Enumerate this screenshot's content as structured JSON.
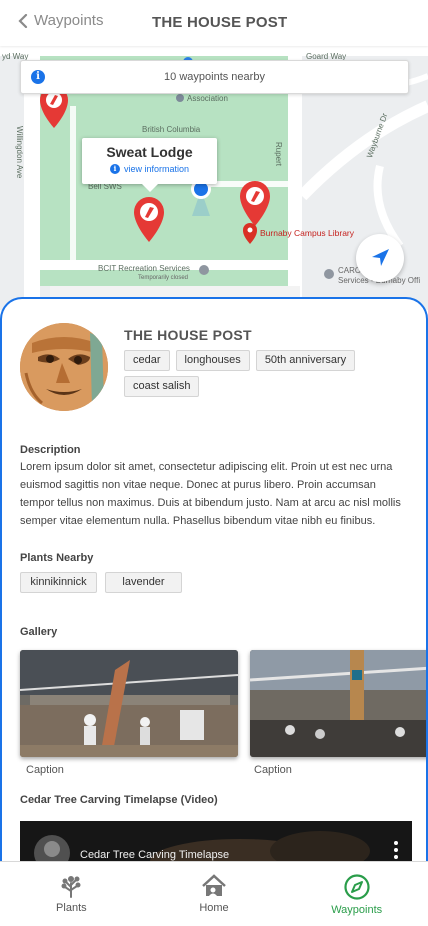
{
  "header": {
    "back_label": "Waypoints",
    "title": "THE HOUSE POST"
  },
  "map": {
    "banner_text": "10 waypoints nearby",
    "popup_title": "Sweat Lodge",
    "popup_link": "view information",
    "labels": {
      "association": "Association",
      "british_columbia": "British Columbia",
      "bcit_recreation": "BCIT Recreation Services",
      "library": "Burnaby Campus Library",
      "willingdon": "Willingdon Ave",
      "goard_way": "Goard Way",
      "rupert": "Rupert",
      "wayburne": "Wayburne Dr",
      "caro": "CARO",
      "services_burnaby": "Services - Burnaby Offi",
      "sweat_short": "Bell SWS",
      "temp_parking": "Temporarily closed",
      "yd_way": "yd Way"
    },
    "colors": {
      "park": "#a8d8b4",
      "road": "#ffffff",
      "marker": "#e53935",
      "user_dot": "#1a73e8",
      "accent": "#1a73e8"
    }
  },
  "waypoint": {
    "title": "THE HOUSE POST",
    "tags": [
      "cedar",
      "longhouses",
      "50th anniversary",
      "coast salish"
    ],
    "description_title": "Description",
    "description": "Lorem ipsum dolor sit amet, consectetur adipiscing elit. Proin ut est nec urna euismod sagittis non vitae neque. Donec at purus libero. Proin accumsan tempor tellus non maximus. Duis at bibendum justo. Nam at arcu ac nisl mollis semper vitae elementum nulla. Phasellus bibendum vitae nibh eu finibus.",
    "plants_title": "Plants Nearby",
    "plants": [
      "kinnikinnick",
      "lavender"
    ],
    "gallery_title": "Gallery",
    "gallery": [
      {
        "caption": "Caption"
      },
      {
        "caption": "Caption"
      }
    ],
    "video_section_title": "Cedar Tree Carving Timelapse (Video)",
    "video_title": "Cedar Tree Carving Timelapse"
  },
  "nav": {
    "items": [
      {
        "label": "Plants",
        "icon": "tree-icon"
      },
      {
        "label": "Home",
        "icon": "house-icon"
      },
      {
        "label": "Waypoints",
        "icon": "compass-icon"
      }
    ],
    "active": "Waypoints",
    "active_color": "#2a9d4a"
  }
}
